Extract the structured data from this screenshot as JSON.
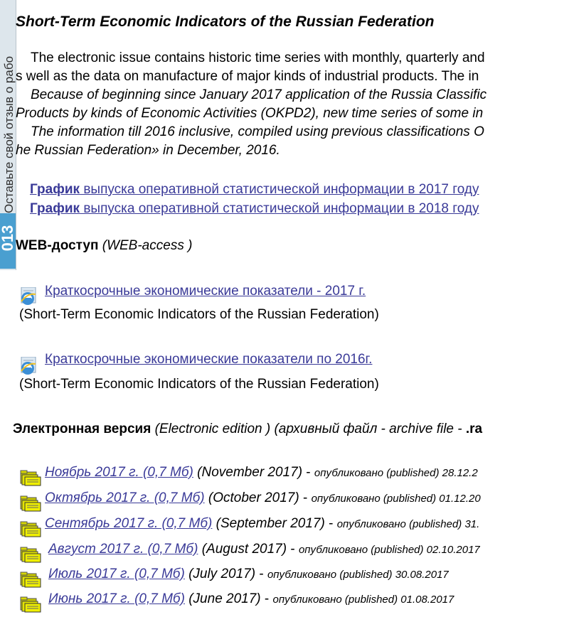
{
  "title": "Short-Term Economic Indicators of the Russian Federation",
  "intro": {
    "line1": "The electronic issue contains historic time series with monthly, quarterly and",
    "line2": "s well as the data on manufacture of major kinds of industrial products. The in",
    "line3": "Because of beginning since January 2017 application of the Russia Classific",
    "line4": "Products by kinds of Economic Activities (OKPD2), new time series of some in",
    "line5": "The information till 2016 inclusive, compiled using previous classifications O",
    "line6": "he Russian Federation» in December, 2016."
  },
  "schedule": [
    {
      "bold": "График",
      "rest": " выпуска оперативной статистической информации в 2017 году"
    },
    {
      "bold": "График",
      "rest": " выпуска оперативной статистической информации в 2018 году"
    }
  ],
  "web_section": {
    "title": "WEB-доступ",
    "subtitle": "(WEB-access )",
    "items": [
      {
        "link": "Краткосрочные экономические показатели - 2017 г.",
        "sub": "(Short-Term Economic Indicators of the Russian Federation)"
      },
      {
        "link": "Краткосрочные экономические показатели по 2016г.",
        "sub": "(Short-Term Economic Indicators of the Russian Federation)"
      }
    ]
  },
  "electronic_section": {
    "title": "Электронная версия",
    "subtitle": "(Electronic edition ) (архивный файл - archive file - ",
    "ext": ".ra"
  },
  "archive": [
    {
      "link": "Ноябрь 2017 г. (0,7 Мб)",
      "eng": "(November 2017)",
      "pub": "опубликовано (published) 28.12.2"
    },
    {
      "link": "Октябрь 2017 г. (0,7 Мб)",
      "eng": "(October 2017)",
      "pub": "опубликовано (published) 01.12.20"
    },
    {
      "link": "Сентябрь 2017 г. (0,7 Мб)",
      "eng": "(September 2017)",
      "pub": "опубликовано (published) 31."
    },
    {
      "link": "Август 2017 г. (0,7 Мб)",
      "eng": "(August 2017)",
      "pub": "опубликовано (published) 02.10.2017"
    },
    {
      "link": "Июль 2017 г. (0,7 Мб)",
      "eng": "(July 2017)",
      "pub": "опубликовано (published) 30.08.2017"
    },
    {
      "link": "Июнь 2017 г. (0,7 Мб)",
      "eng": "(June 2017)",
      "pub": "опубликовано (published) 01.08.2017"
    }
  ],
  "feedback": {
    "label": "Оставьте свой отзыв о рабо",
    "badge": "013"
  },
  "colors": {
    "link": "#3a3a98",
    "badge": "#4a9fd0"
  }
}
